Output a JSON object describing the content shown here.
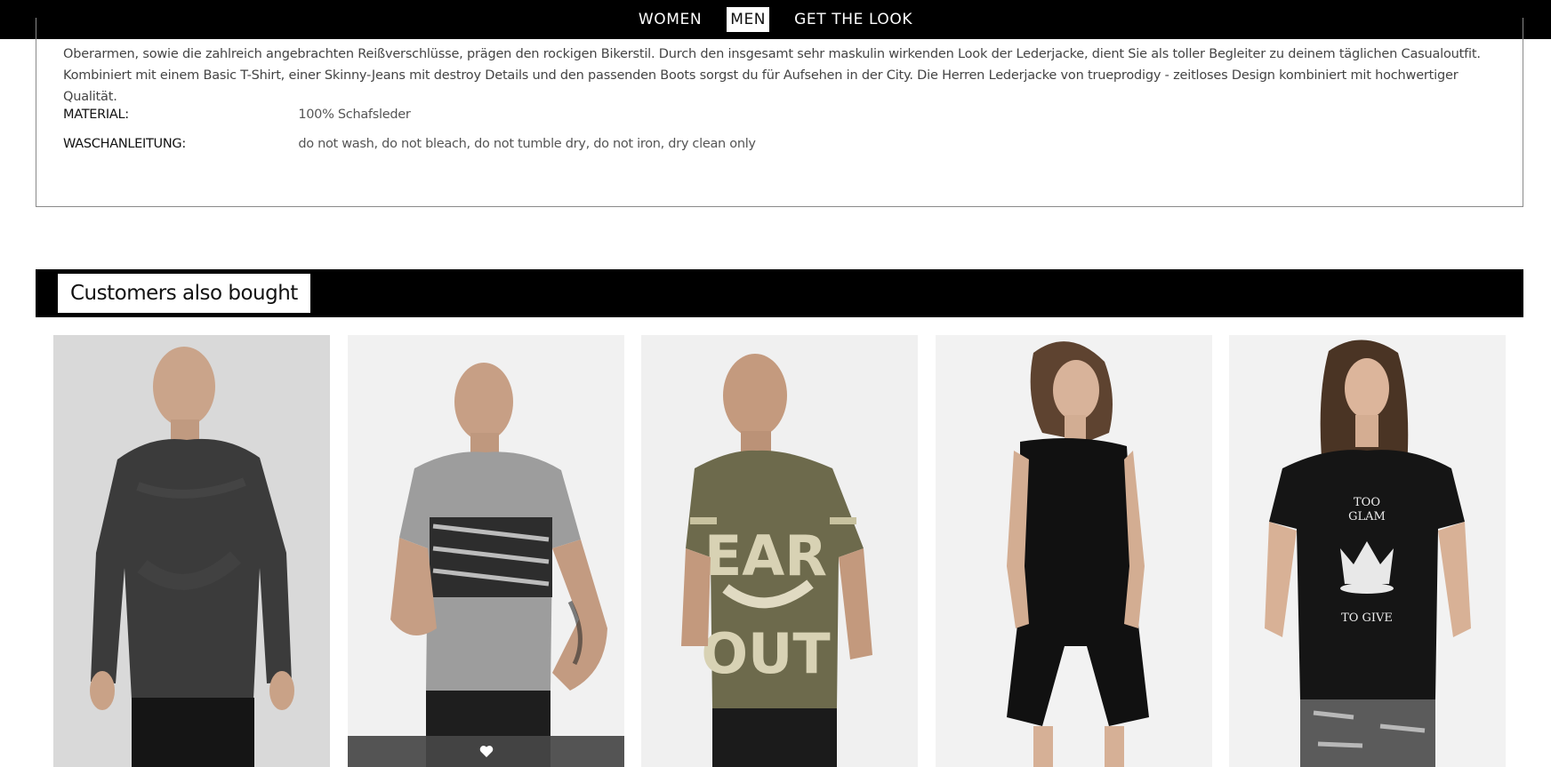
{
  "nav": {
    "items": [
      {
        "label": "WOMEN",
        "active": false
      },
      {
        "label": "MEN",
        "active": true
      },
      {
        "label": "GET THE LOOK",
        "active": false
      }
    ]
  },
  "description": {
    "line1": "Oberarmen, sowie die zahlreich angebrachten Reißverschlüsse, prägen den rockigen Bikerstil. Durch den insgesamt sehr maskulin wirkenden Look der Lederjacke, dient Sie als toller Begleiter zu deinem täglichen Casualoutfit.",
    "line2": "Kombiniert mit einem Basic T-Shirt, einer Skinny-Jeans mit destroy Details und den passenden Boots sorgst du für Aufsehen in der City. Die Herren Lederjacke von trueprodigy - zeitloses Design kombiniert mit hochwertiger Qualität.",
    "material_label": "MATERIAL:",
    "material_value": "100% Schafsleder",
    "wash_label": "WASCHANLEITUNG:",
    "wash_value": "do not wash, do not bleach, do not tumble dry, do not iron, dry clean only"
  },
  "customers_also_bought": {
    "title": "Customers also bought",
    "products": [
      {
        "image": "man-dark-washed-longsleeve",
        "color": "#3a3a3a"
      },
      {
        "image": "man-grey-printed-tshirt",
        "color": "#9b9b9b",
        "wishlist_icon": "heart-icon"
      },
      {
        "image": "man-olive-graphic-tshirt",
        "color": "#6f6c4e"
      },
      {
        "image": "woman-black-playsuit",
        "color": "#111111"
      },
      {
        "image": "woman-black-crown-tshirt",
        "color": "#141414"
      }
    ],
    "print_text": {
      "p3_top": "EAR",
      "p3_bottom": "OUT",
      "p5_line1": "TOO",
      "p5_line2": "GLAM",
      "p5_line3": "TO GIVE"
    }
  }
}
